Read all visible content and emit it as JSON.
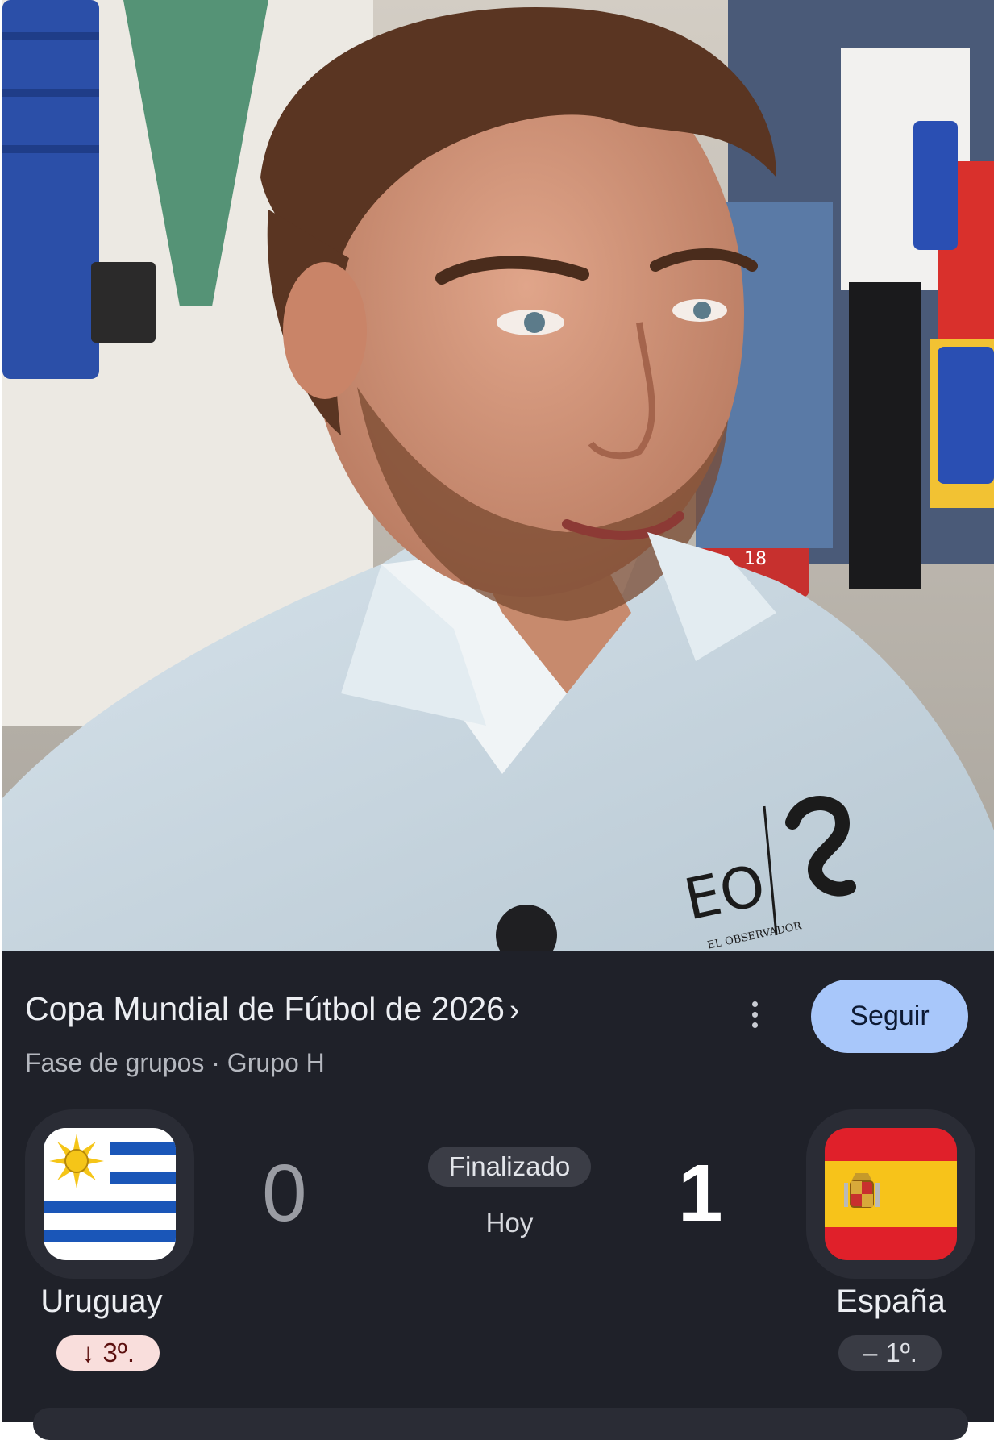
{
  "competition": {
    "title": "Copa Mundial de Fútbol de 2026",
    "chevron": "›",
    "stage": "Fase de grupos · Grupo H",
    "follow_label": "Seguir",
    "more_icon": "more-vert-icon"
  },
  "match": {
    "status": "Finalizado",
    "date": "Hoy",
    "home": {
      "name": "Uruguay",
      "score": "0",
      "rank_arrow": "↓",
      "rank": "3º.",
      "rank_trend": "down",
      "flag_icon": "uruguay-flag-icon"
    },
    "away": {
      "name": "España",
      "score": "1",
      "rank_arrow": "–",
      "rank": "1º.",
      "rank_trend": "same",
      "flag_icon": "spain-flag-icon"
    }
  },
  "photo": {
    "shirt_logo_text": "EO",
    "shirt_logo_subtext": "EL OBSERVADOR",
    "seat_number": "18"
  },
  "colors": {
    "card_bg": "#1f2129",
    "follow_button": "#a8c7fa",
    "rank_down_bg": "#f9dedc",
    "rank_same_bg": "#393b44"
  }
}
